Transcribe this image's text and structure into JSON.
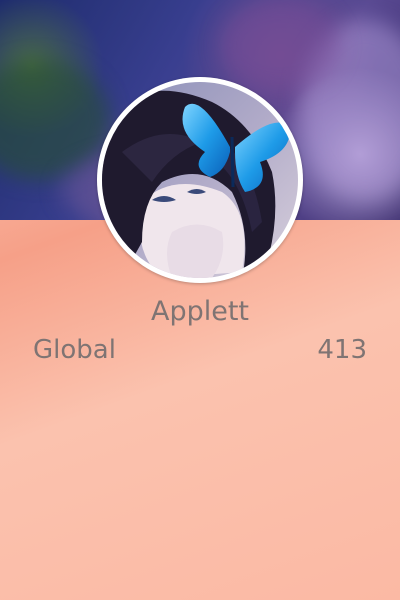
{
  "profile": {
    "banner_image": "blurred-anime-banner",
    "avatar_image": "anime-character-with-blue-butterfly",
    "username": "Applett"
  },
  "stats": {
    "scope_label": "Global",
    "value": "413"
  },
  "colors": {
    "text": "#7f7473",
    "avatar_ring": "#ffffff",
    "card_background": "#f8b09c",
    "butterfly": "#1e9be8"
  }
}
